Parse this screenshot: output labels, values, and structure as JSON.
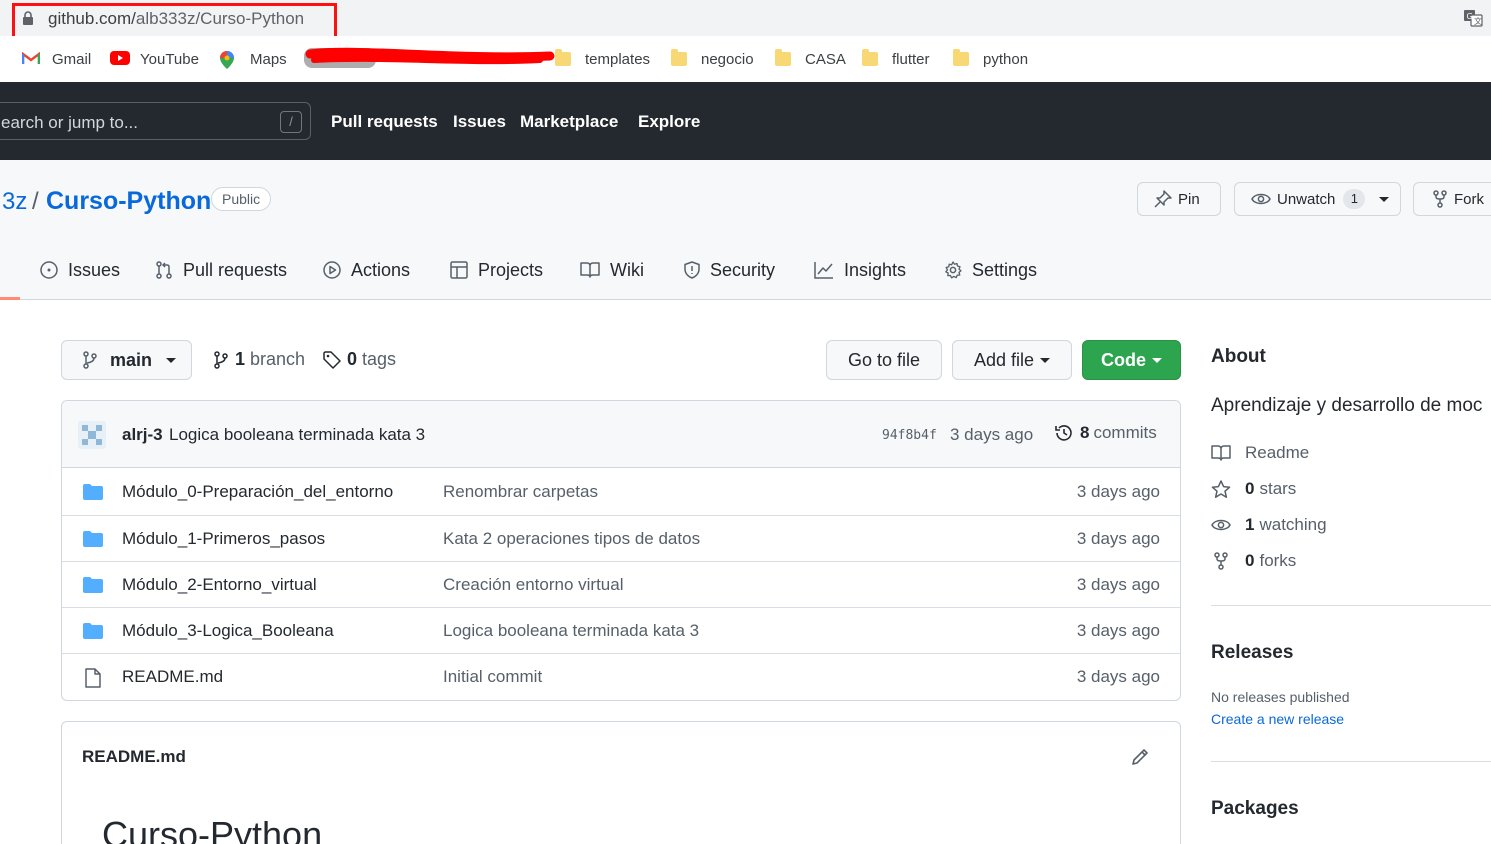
{
  "browser": {
    "url_host": "github.com/",
    "url_path": "alb333z/Curso-Python",
    "bookmarks": [
      {
        "label": "Gmail",
        "icon": "gmail-icon"
      },
      {
        "label": "YouTube",
        "icon": "youtube-icon"
      },
      {
        "label": "Maps",
        "icon": "maps-icon"
      },
      {
        "label": "templates",
        "icon": "folder-icon"
      },
      {
        "label": "negocio",
        "icon": "folder-icon"
      },
      {
        "label": "CASA",
        "icon": "folder-icon"
      },
      {
        "label": "flutter",
        "icon": "folder-icon"
      },
      {
        "label": "python",
        "icon": "folder-icon"
      }
    ]
  },
  "header": {
    "search_placeholder": "earch or jump to...",
    "search_key": "/",
    "nav": [
      "Pull requests",
      "Issues",
      "Marketplace",
      "Explore"
    ]
  },
  "repo": {
    "owner": "3z",
    "separator": "/",
    "name": "Curso-Python",
    "visibility": "Public",
    "pin_label": "Pin",
    "unwatch_label": "Unwatch",
    "watch_count": "1",
    "fork_label": "Fork"
  },
  "tabs": [
    "Issues",
    "Pull requests",
    "Actions",
    "Projects",
    "Wiki",
    "Security",
    "Insights",
    "Settings"
  ],
  "toolbar": {
    "branch": "main",
    "branch_count": "1",
    "branch_word": "branch",
    "tag_count": "0",
    "tag_word": "tags",
    "go_to_file": "Go to file",
    "add_file": "Add file",
    "code": "Code"
  },
  "latest_commit": {
    "author": "alrj-3",
    "message": "Logica booleana terminada kata 3",
    "sha": "94f8b4f",
    "age": "3 days ago",
    "count": "8",
    "count_word": "commits"
  },
  "files": [
    {
      "type": "dir",
      "name": "Módulo_0-Preparación_del_entorno",
      "message": "Renombrar carpetas",
      "age": "3 days ago"
    },
    {
      "type": "dir",
      "name": "Módulo_1-Primeros_pasos",
      "message": "Kata 2 operaciones tipos de datos",
      "age": "3 days ago"
    },
    {
      "type": "dir",
      "name": "Módulo_2-Entorno_virtual",
      "message": "Creación entorno virtual",
      "age": "3 days ago"
    },
    {
      "type": "dir",
      "name": "Módulo_3-Logica_Booleana",
      "message": "Logica booleana terminada kata 3",
      "age": "3 days ago"
    },
    {
      "type": "file",
      "name": "README.md",
      "message": "Initial commit",
      "age": "3 days ago"
    }
  ],
  "readme": {
    "title": "README.md",
    "heading": "Curso-Python"
  },
  "sidebar": {
    "about_title": "About",
    "description": "Aprendizaje y desarrollo de moc",
    "readme": "Readme",
    "stars_count": "0",
    "stars_word": "stars",
    "watching_count": "1",
    "watching_word": "watching",
    "forks_count": "0",
    "forks_word": "forks",
    "releases_title": "Releases",
    "no_releases": "No releases published",
    "create_release": "Create a new release",
    "packages_title": "Packages"
  },
  "colors": {
    "header_bg": "#24292f",
    "link": "#0969da",
    "code_button": "#2da44e",
    "folder": "#54aeff",
    "highlight": "#ff1010"
  }
}
